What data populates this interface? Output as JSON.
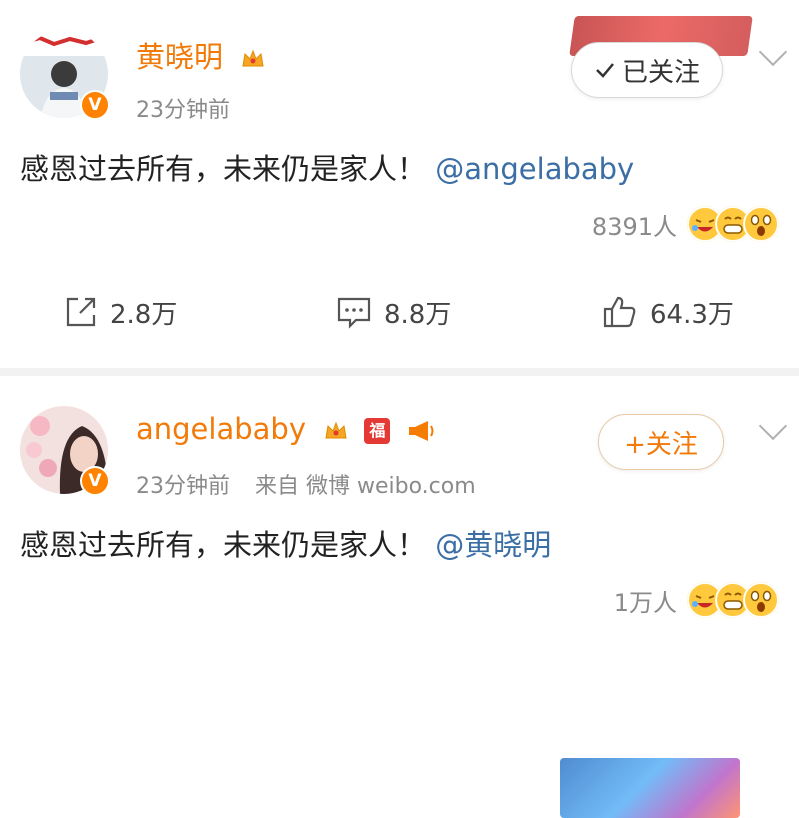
{
  "post1": {
    "username": "黄晓明",
    "time": "23分钟前",
    "follow_label": "已关注",
    "follow_icon": "check-icon",
    "content_text": "感恩过去所有，未来仍是家人！",
    "mention": "@angelababy",
    "reaction_count": "8391人",
    "repost_count": "2.8万",
    "comment_count": "8.8万",
    "like_count": "64.3万",
    "verified_badge": "V"
  },
  "post2": {
    "username": "angelababy",
    "time": "23分钟前",
    "source": "来自 微博 weibo.com",
    "follow_label": "+关注",
    "fu_badge": "福",
    "content_text": "感恩过去所有，未来仍是家人！",
    "mention": "@黄晓明",
    "reaction_count": "1万人",
    "verified_badge": "V"
  },
  "colors": {
    "username": "#f17a09",
    "mention": "#3a6ea5",
    "verified": "#ff8200",
    "meta": "#8a8a8a"
  }
}
